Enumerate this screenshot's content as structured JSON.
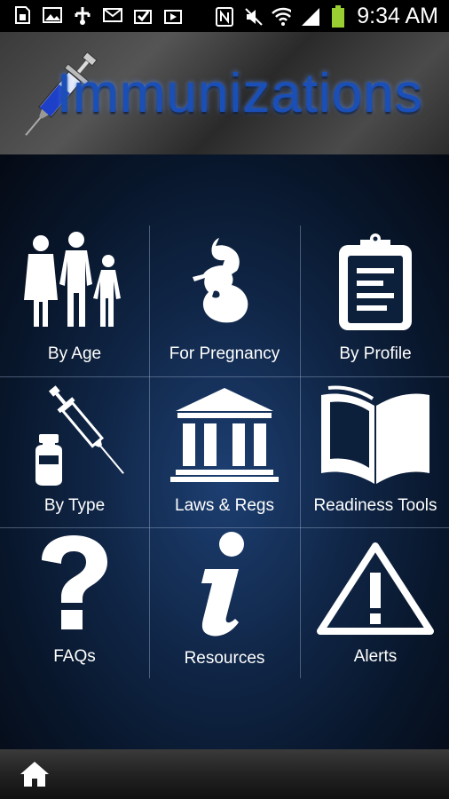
{
  "status_bar": {
    "time": "9:34 AM",
    "left_icons": [
      "sd-card-icon",
      "image-icon",
      "usb-icon",
      "mail-icon",
      "download-icon",
      "upload-icon"
    ],
    "right_icons": [
      "nfc-icon",
      "mute-icon",
      "wifi-icon",
      "signal-icon",
      "battery-icon"
    ]
  },
  "header": {
    "title": "Immunizations"
  },
  "menu": {
    "tiles": [
      {
        "label": "By Age",
        "icon": "family-icon"
      },
      {
        "label": "For Pregnancy",
        "icon": "pregnancy-icon"
      },
      {
        "label": "By Profile",
        "icon": "clipboard-icon"
      },
      {
        "label": "By Type",
        "icon": "vaccine-icon"
      },
      {
        "label": "Laws & Regs",
        "icon": "courthouse-icon"
      },
      {
        "label": "Readiness Tools",
        "icon": "book-icon"
      },
      {
        "label": "FAQs",
        "icon": "question-icon"
      },
      {
        "label": "Resources",
        "icon": "info-icon"
      },
      {
        "label": "Alerts",
        "icon": "warning-icon"
      }
    ]
  },
  "bottom_bar": {
    "home_icon": "home-icon"
  },
  "colors": {
    "accent": "#1a4fb8",
    "background": "#0b1c36",
    "icon": "#ffffff"
  }
}
